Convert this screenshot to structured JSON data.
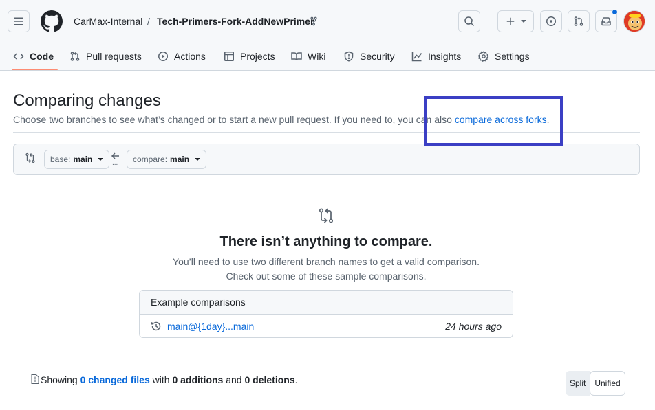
{
  "header": {
    "owner": "CarMax-Internal",
    "separator": "/",
    "repo": "Tech-Primers-Fork-AddNewPrimer"
  },
  "tabs": [
    {
      "label": "Code",
      "icon": "code-icon",
      "active": true
    },
    {
      "label": "Pull requests",
      "icon": "git-pull-request-icon"
    },
    {
      "label": "Actions",
      "icon": "play-icon"
    },
    {
      "label": "Projects",
      "icon": "table-icon"
    },
    {
      "label": "Wiki",
      "icon": "book-icon"
    },
    {
      "label": "Security",
      "icon": "shield-icon"
    },
    {
      "label": "Insights",
      "icon": "graph-icon"
    },
    {
      "label": "Settings",
      "icon": "gear-icon"
    }
  ],
  "main": {
    "title": "Comparing changes",
    "subtitle_text": "Choose two branches to see what’s changed or to start a new pull request. If you need to, you can also ",
    "subtitle_link": "compare across forks",
    "subtitle_end": "."
  },
  "range": {
    "base_label": "base:",
    "base_value": "main",
    "compare_label": "compare:",
    "compare_value": "main",
    "dots": "..."
  },
  "empty": {
    "title": "There isn’t anything to compare.",
    "line1": "You’ll need to use two different branch names to get a valid comparison.",
    "line2": "Check out some of these sample comparisons."
  },
  "examples": {
    "heading": "Example comparisons",
    "rows": [
      {
        "link": "main@{1day}...main",
        "time": "24 hours ago"
      }
    ]
  },
  "summary": {
    "showing": "Showing ",
    "changed_files": "0 changed files",
    "with": " with ",
    "additions": "0 additions",
    "and": " and ",
    "deletions": "0 deletions",
    "end": "."
  },
  "view_toggle": {
    "split": "Split",
    "unified": "Unified"
  },
  "colors": {
    "accent": "#0969da",
    "tab_underline": "#fd8c73",
    "annotation_box": "#3b3fc4"
  }
}
